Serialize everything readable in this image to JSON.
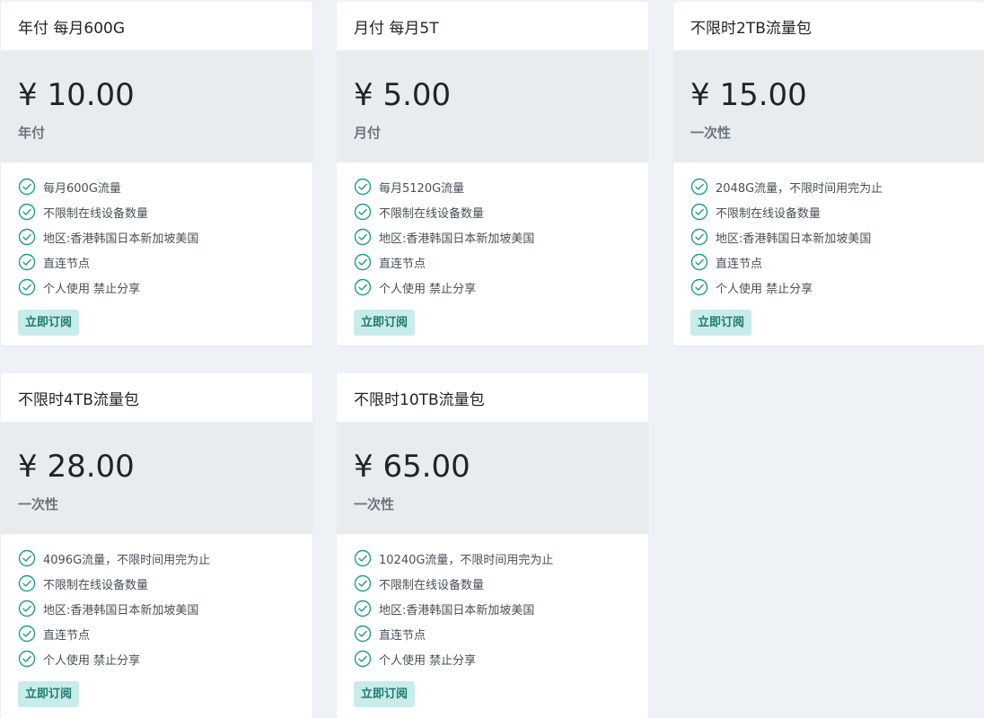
{
  "accent_color": "#1f9d8f",
  "button_bg": "#c8ecea",
  "plans": [
    {
      "title": "年付 每月600G",
      "price": "¥ 10.00",
      "period": "年付",
      "features": [
        "每月600G流量",
        "不限制在线设备数量",
        "地区:香港韩国日本新加坡美国",
        "直连节点",
        "个人使用 禁止分享"
      ],
      "button": "立即订阅"
    },
    {
      "title": "月付 每月5T",
      "price": "¥ 5.00",
      "period": "月付",
      "features": [
        "每月5120G流量",
        "不限制在线设备数量",
        "地区:香港韩国日本新加坡美国",
        "直连节点",
        "个人使用 禁止分享"
      ],
      "button": "立即订阅"
    },
    {
      "title": "不限时2TB流量包",
      "price": "¥ 15.00",
      "period": "一次性",
      "features": [
        "2048G流量，不限时间用完为止",
        "不限制在线设备数量",
        "地区:香港韩国日本新加坡美国",
        "直连节点",
        "个人使用 禁止分享"
      ],
      "button": "立即订阅"
    },
    {
      "title": "不限时4TB流量包",
      "price": "¥ 28.00",
      "period": "一次性",
      "features": [
        "4096G流量，不限时间用完为止",
        "不限制在线设备数量",
        "地区:香港韩国日本新加坡美国",
        "直连节点",
        "个人使用 禁止分享"
      ],
      "button": "立即订阅"
    },
    {
      "title": "不限时10TB流量包",
      "price": "¥ 65.00",
      "period": "一次性",
      "features": [
        "10240G流量，不限时间用完为止",
        "不限制在线设备数量",
        "地区:香港韩国日本新加坡美国",
        "直连节点",
        "个人使用 禁止分享"
      ],
      "button": "立即订阅"
    }
  ]
}
